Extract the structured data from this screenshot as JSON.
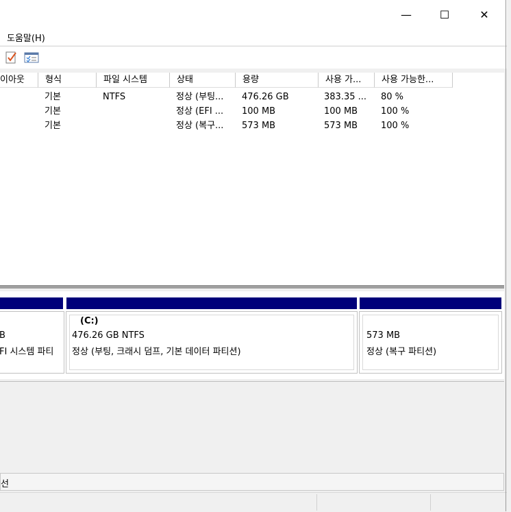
{
  "titlebar": {
    "minimize_glyph": "—",
    "maximize_glyph": "☐",
    "close_glyph": "✕"
  },
  "menu": {
    "help_label": "도움말(H)"
  },
  "volume_list": {
    "columns": [
      "이아웃",
      "형식",
      "파일 시스템",
      "상태",
      "용량",
      "사용 가...",
      "사용 가능한..."
    ],
    "rows": [
      {
        "type": "기본",
        "fs": "NTFS",
        "status": "정상 (부팅...",
        "capacity": "476.26 GB",
        "free": "383.35 ...",
        "pct": "80 %"
      },
      {
        "type": "기본",
        "fs": "",
        "status": "정상 (EFI ...",
        "capacity": "100 MB",
        "free": "100 MB",
        "pct": "100 %"
      },
      {
        "type": "기본",
        "fs": "",
        "status": "정상 (복구...",
        "capacity": "573 MB",
        "free": "573 MB",
        "pct": "100 %"
      }
    ]
  },
  "disk_map": {
    "partitions": [
      {
        "line1": "B",
        "line2": "FI 시스템 파티"
      },
      {
        "name": "(C:)",
        "line1": "476.26 GB NTFS",
        "line2": "정상 (부팅, 크래시 덤프, 기본 데이터 파티션)"
      },
      {
        "line1": "573 MB",
        "line2": "정상 (복구 파티션)"
      }
    ],
    "bar_color": "#00007a"
  },
  "legend": {
    "text": "선"
  }
}
